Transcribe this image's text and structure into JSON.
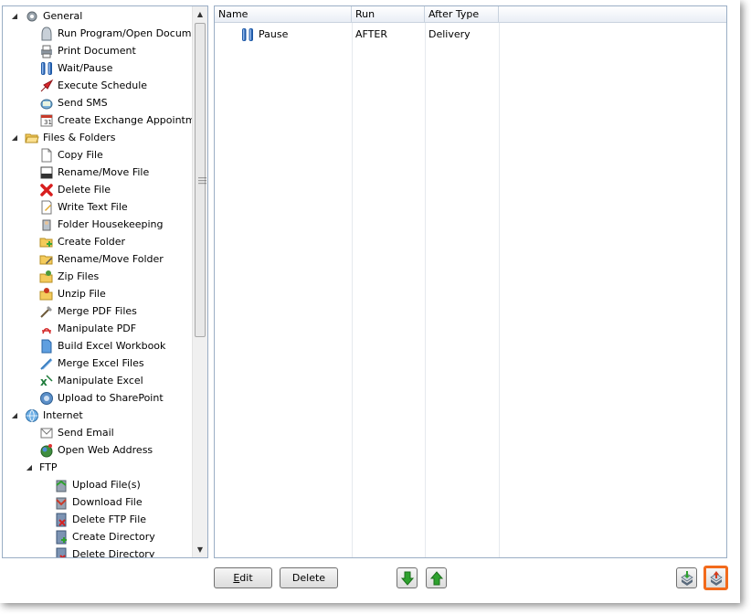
{
  "tree": {
    "items": [
      {
        "label": "General",
        "level": 0,
        "expanded": true,
        "icon": "gear-icon"
      },
      {
        "label": "Run Program/Open Document",
        "level": 1,
        "icon": "run-program-icon"
      },
      {
        "label": "Print Document",
        "level": 1,
        "icon": "printer-icon"
      },
      {
        "label": "Wait/Pause",
        "level": 1,
        "icon": "pause-icon"
      },
      {
        "label": "Execute Schedule",
        "level": 1,
        "icon": "execute-schedule-icon"
      },
      {
        "label": "Send SMS",
        "level": 1,
        "icon": "sms-icon"
      },
      {
        "label": "Create Exchange Appointment",
        "level": 1,
        "icon": "appointment-icon"
      },
      {
        "label": "Files & Folders",
        "level": 0,
        "expanded": true,
        "icon": "folder-open-icon"
      },
      {
        "label": "Copy File",
        "level": 1,
        "icon": "copy-file-icon"
      },
      {
        "label": "Rename/Move File",
        "level": 1,
        "icon": "rename-file-icon"
      },
      {
        "label": "Delete File",
        "level": 1,
        "icon": "delete-x-icon"
      },
      {
        "label": "Write Text File",
        "level": 1,
        "icon": "write-text-icon"
      },
      {
        "label": "Folder Housekeeping",
        "level": 1,
        "icon": "housekeeping-icon"
      },
      {
        "label": "Create Folder",
        "level": 1,
        "icon": "create-folder-icon"
      },
      {
        "label": "Rename/Move Folder",
        "level": 1,
        "icon": "rename-folder-icon"
      },
      {
        "label": "Zip Files",
        "level": 1,
        "icon": "zip-icon"
      },
      {
        "label": "Unzip File",
        "level": 1,
        "icon": "unzip-icon"
      },
      {
        "label": "Merge PDF Files",
        "level": 1,
        "icon": "merge-pdf-icon"
      },
      {
        "label": "Manipulate PDF",
        "level": 1,
        "icon": "pdf-icon"
      },
      {
        "label": "Build Excel Workbook",
        "level": 1,
        "icon": "excel-workbook-icon"
      },
      {
        "label": "Merge Excel Files",
        "level": 1,
        "icon": "merge-excel-icon"
      },
      {
        "label": "Manipulate Excel",
        "level": 1,
        "icon": "excel-icon"
      },
      {
        "label": "Upload to SharePoint",
        "level": 1,
        "icon": "sharepoint-icon"
      },
      {
        "label": "Internet",
        "level": 0,
        "expanded": true,
        "icon": "globe-icon"
      },
      {
        "label": "Send Email",
        "level": 1,
        "icon": "email-icon"
      },
      {
        "label": "Open Web Address",
        "level": 1,
        "icon": "web-address-icon"
      },
      {
        "label": "FTP",
        "level": 1,
        "expanded": true,
        "icon": ""
      },
      {
        "label": "Upload File(s)",
        "level": 2,
        "icon": "ftp-upload-icon"
      },
      {
        "label": "Download File",
        "level": 2,
        "icon": "ftp-download-icon"
      },
      {
        "label": "Delete FTP File",
        "level": 2,
        "icon": "ftp-delete-icon"
      },
      {
        "label": "Create Directory",
        "level": 2,
        "icon": "ftp-create-dir-icon"
      },
      {
        "label": "Delete Directory",
        "level": 2,
        "icon": "ftp-delete-dir-icon"
      }
    ],
    "scrollbar_thumb_fraction": 0.58
  },
  "list": {
    "columns": [
      {
        "label": "Name"
      },
      {
        "label": "Run"
      },
      {
        "label": "After Type"
      }
    ],
    "rows": [
      {
        "name": "Pause",
        "run": "AFTER",
        "after_type": "Delivery",
        "icon": "pause-icon"
      }
    ]
  },
  "buttons": {
    "edit_prefix": "E",
    "edit_rest": "dit",
    "delete": "Delete",
    "move_down": "arrow-down-icon",
    "move_up": "arrow-up-icon",
    "import": "import-icon",
    "export": "export-icon"
  },
  "colors": {
    "highlight": "#f26a1b",
    "arrow_green": "#2ea12e",
    "pause_blue": "#1f5aa8"
  }
}
